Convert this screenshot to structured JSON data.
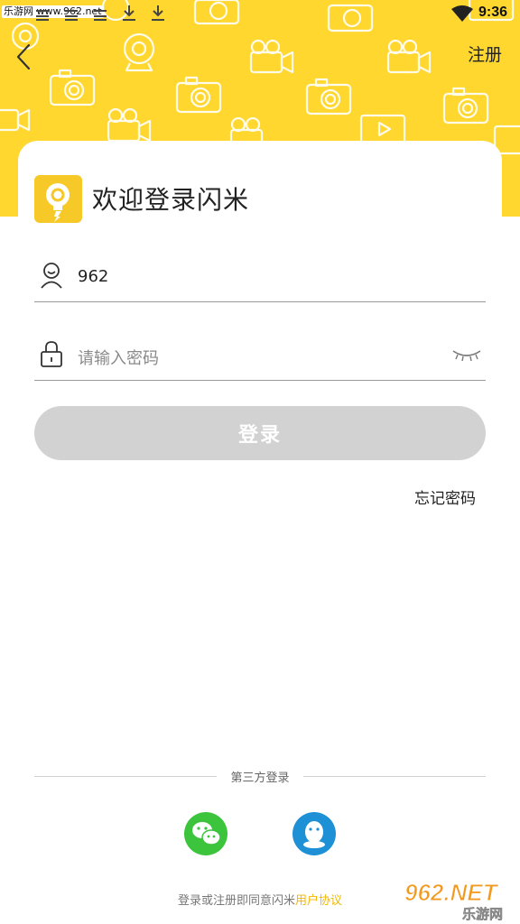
{
  "status_bar": {
    "watermark": "乐游网 www.962.net",
    "time": "9:36"
  },
  "header": {
    "background_color": "#FFD72E",
    "back_icon": "chevron-left-icon",
    "register_label": "注册"
  },
  "login": {
    "title": "欢迎登录闪米",
    "username_value": "962",
    "password_placeholder": "请输入密码",
    "login_button": "登录",
    "login_button_color": "#d2d2d2",
    "forgot_password": "忘记密码"
  },
  "third_party": {
    "label": "第三方登录",
    "options": [
      {
        "name": "wechat",
        "icon": "wechat-icon",
        "color": "#3CC43C"
      },
      {
        "name": "qq",
        "icon": "qq-icon",
        "color": "#1E90D6"
      }
    ]
  },
  "agreement": {
    "prefix": "登录或注册即同意闪米",
    "link": "用户协议",
    "link_color": "#F2B705"
  },
  "watermark_bottom": {
    "brand": "962.NET",
    "sub": "乐游网"
  }
}
